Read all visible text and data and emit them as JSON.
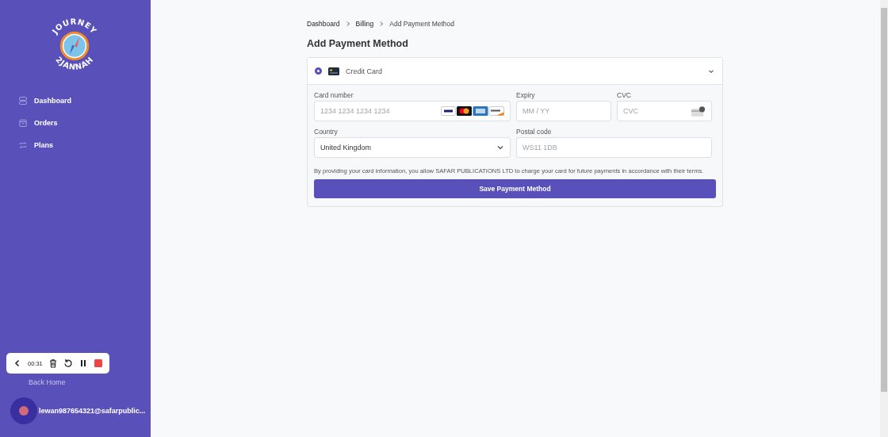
{
  "logo": {
    "top_text": "JOURNEY",
    "bottom_text": "2JANNAH"
  },
  "nav": [
    {
      "label": "Dashboard",
      "kind": "dashboard"
    },
    {
      "label": "Orders",
      "kind": "orders"
    },
    {
      "label": "Plans",
      "kind": "plans"
    }
  ],
  "back_link": "Back Home",
  "user": {
    "email": "lewan987654321@safarpublic..."
  },
  "recorder": {
    "time": "00:31"
  },
  "breadcrumb": [
    "Dashboard",
    "Billing",
    "Add Payment Method"
  ],
  "title": "Add Payment Method",
  "payment_method": {
    "label": "Credit Card",
    "selected": true,
    "expanded": true
  },
  "fields": {
    "card_number": {
      "label": "Card number",
      "placeholder": "1234 1234 1234 1234"
    },
    "expiry": {
      "label": "Expiry",
      "placeholder": "MM / YY"
    },
    "cvc": {
      "label": "CVC",
      "placeholder": "CVC"
    },
    "country": {
      "label": "Country",
      "value": "United Kingdom"
    },
    "postal_code": {
      "label": "Postal code",
      "placeholder": "WS11 1DB"
    }
  },
  "consent_text": "By providing your card information, you allow SAFAR PUBLICATIONS LTD to charge your card for future payments in accordance with their terms.",
  "submit": "Save Payment Method"
}
